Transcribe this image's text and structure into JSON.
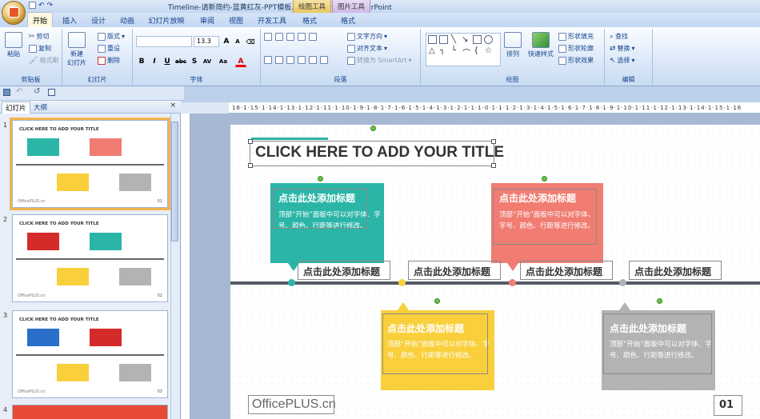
{
  "window": {
    "title": "Timeline-请新简约-蓝黄红灰-PPT模板.pptx - Microsoft PowerPoint"
  },
  "context_tabs": [
    "绘图工具",
    "图片工具"
  ],
  "tabs": [
    "开始",
    "插入",
    "设计",
    "动画",
    "幻灯片放映",
    "审阅",
    "视图",
    "开发工具",
    "格式",
    "格式"
  ],
  "ribbon": {
    "clipboard": {
      "paste": "粘贴",
      "cut": "剪切",
      "copy": "复制",
      "format_painter": "格式刷",
      "label": "剪贴板"
    },
    "slides": {
      "new_slide": "新建\n幻灯片",
      "layout": "版式",
      "reset": "重设",
      "delete": "删除",
      "label": "幻灯片"
    },
    "font": {
      "font_size": "13.3",
      "label": "字体"
    },
    "paragraph": {
      "text_direction": "文字方向",
      "align_text": "对齐文本",
      "smartart": "转换为 SmartArt",
      "label": "段落"
    },
    "drawing": {
      "arrange": "排列",
      "quick_styles": "快速样式",
      "shape_fill": "形状填充",
      "shape_outline": "形状轮廓",
      "shape_effects": "形状效果",
      "label": "绘图"
    },
    "editing": {
      "find": "查找",
      "replace": "替换",
      "select": "选择",
      "label": "编辑"
    }
  },
  "pane": {
    "tabs": [
      "幻灯片",
      "大纲"
    ],
    "slide_numbers": [
      "1",
      "2",
      "3",
      "4"
    ]
  },
  "thumbnail": {
    "title": "CLICK HERE TO ADD YOUR TITLE",
    "footer": "OfficePLUS.cn",
    "page_numbers": [
      "01",
      "02",
      "03"
    ]
  },
  "ruler": {
    "h_text": "16·1·15·1·14·1·13·1·12·1·11·1·10·1·9·1·8·1·7·1·6·1·5·1·4·1·3·1·2·1·1·1·0·1·1·1·2·1·3·1·4·1·5·1·6·1·7·1·8·1·9·1·10·1·11·1·12·1·13·1·14·1·15·1·16"
  },
  "slide": {
    "title": "CLICK HERE TO ADD YOUR TITLE",
    "card_heading": "点击此处添加标题",
    "card_body": "顶部“开始”面板中可以对字体、字号、颜色、行距等进行修改。",
    "timeline_labels": [
      "点击此处添加标题",
      "点击此处添加标题",
      "点击此处添加标题",
      "点击此处添加标题"
    ],
    "footer_logo": "OfficePLUS.cn",
    "page_number": "01"
  },
  "colors": {
    "teal": "#2bb5a7",
    "salmon": "#f07c72",
    "yellow": "#f9cf3b",
    "gray": "#b3b3b3",
    "timeline": "#555b66",
    "accent_bar": "#2bb5a7"
  }
}
